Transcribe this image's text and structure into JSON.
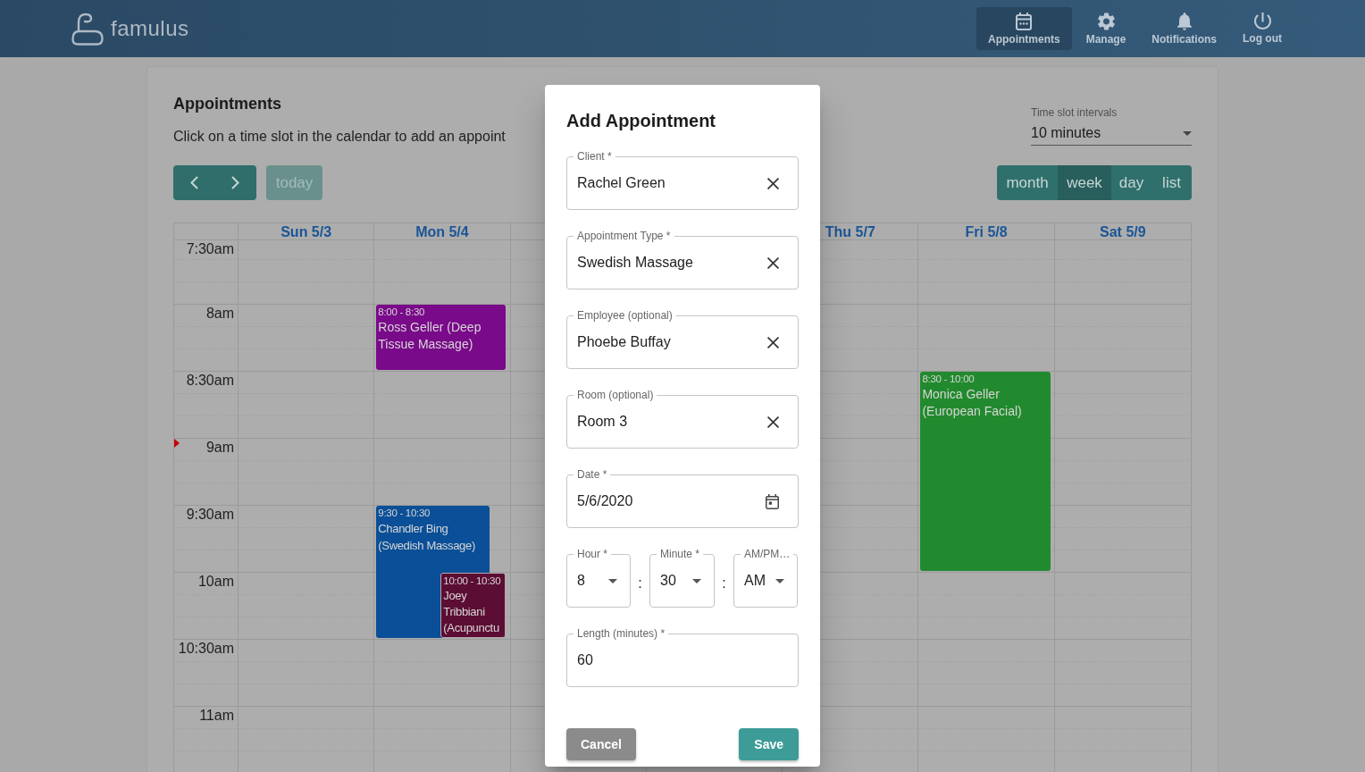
{
  "header": {
    "logo_text": "famulus",
    "nav": [
      {
        "label": "Appointments",
        "selected": true
      },
      {
        "label": "Manage",
        "selected": false
      },
      {
        "label": "Notifications",
        "selected": false
      },
      {
        "label": "Log out",
        "selected": false
      }
    ]
  },
  "page": {
    "title": "Appointments",
    "instructions": "Click on a time slot in the calendar to add an appoint"
  },
  "interval_select": {
    "label": "Time slot intervals",
    "value": "10 minutes"
  },
  "toolbar": {
    "today": {
      "label": "today",
      "disabled": true
    },
    "views": [
      {
        "label": "month",
        "selected": false
      },
      {
        "label": "week",
        "selected": true
      },
      {
        "label": "day",
        "selected": false
      },
      {
        "label": "list",
        "selected": false
      }
    ]
  },
  "calendar": {
    "days": [
      {
        "label": "Sun 5/3"
      },
      {
        "label": "Mon 5/4",
        "events": [
          {
            "time": "8:00 - 8:30",
            "title": "Ross Geller (Deep Tissue Massage)",
            "color": "#790a89"
          },
          {
            "time": "9:30 - 10:30",
            "title": "Chandler Bing (Swedish Massage)",
            "color": "#0a4f97"
          },
          {
            "time": "10:00 - 10:30",
            "title": "Joey Tribbiani (Acupunctu",
            "color": "#5c0d34"
          }
        ]
      },
      {
        "label": "Thu 5/7"
      },
      {
        "label": "Fri 5/8",
        "events": [
          {
            "time": "8:30 - 10:00",
            "title": "Monica Geller (European Facial)",
            "color": "#228a2e"
          }
        ]
      },
      {
        "label": "Sat 5/9"
      }
    ],
    "times": [
      "7:30am",
      "8am",
      "8:30am",
      "9am",
      "9:30am",
      "10am",
      "10:30am",
      "11am"
    ]
  },
  "dialog": {
    "title": "Add Appointment",
    "fields": [
      {
        "kind": "clearable",
        "label": "Client *",
        "value": "Rachel Green"
      },
      {
        "kind": "clearable",
        "label": "Appointment Type *",
        "value": "Swedish Massage"
      },
      {
        "kind": "clearable",
        "label": "Employee (optional)",
        "value": "Phoebe Buffay"
      },
      {
        "kind": "clearable",
        "label": "Room (optional)",
        "value": "Room 3"
      },
      {
        "kind": "date",
        "label": "Date *",
        "value": "5/6/2020"
      }
    ],
    "time_fields": [
      {
        "label": "Hour *",
        "value": "8"
      },
      {
        "label": "Minute *",
        "value": "30"
      },
      {
        "label": "AM/PM…",
        "value": "AM"
      }
    ],
    "time_separators": [
      ":",
      ":"
    ],
    "length_field": {
      "label": "Length (minutes) *",
      "value": "60"
    },
    "buttons": [
      {
        "kind": "secondary",
        "label": "Cancel"
      },
      {
        "kind": "primary",
        "label": "Save"
      }
    ]
  }
}
